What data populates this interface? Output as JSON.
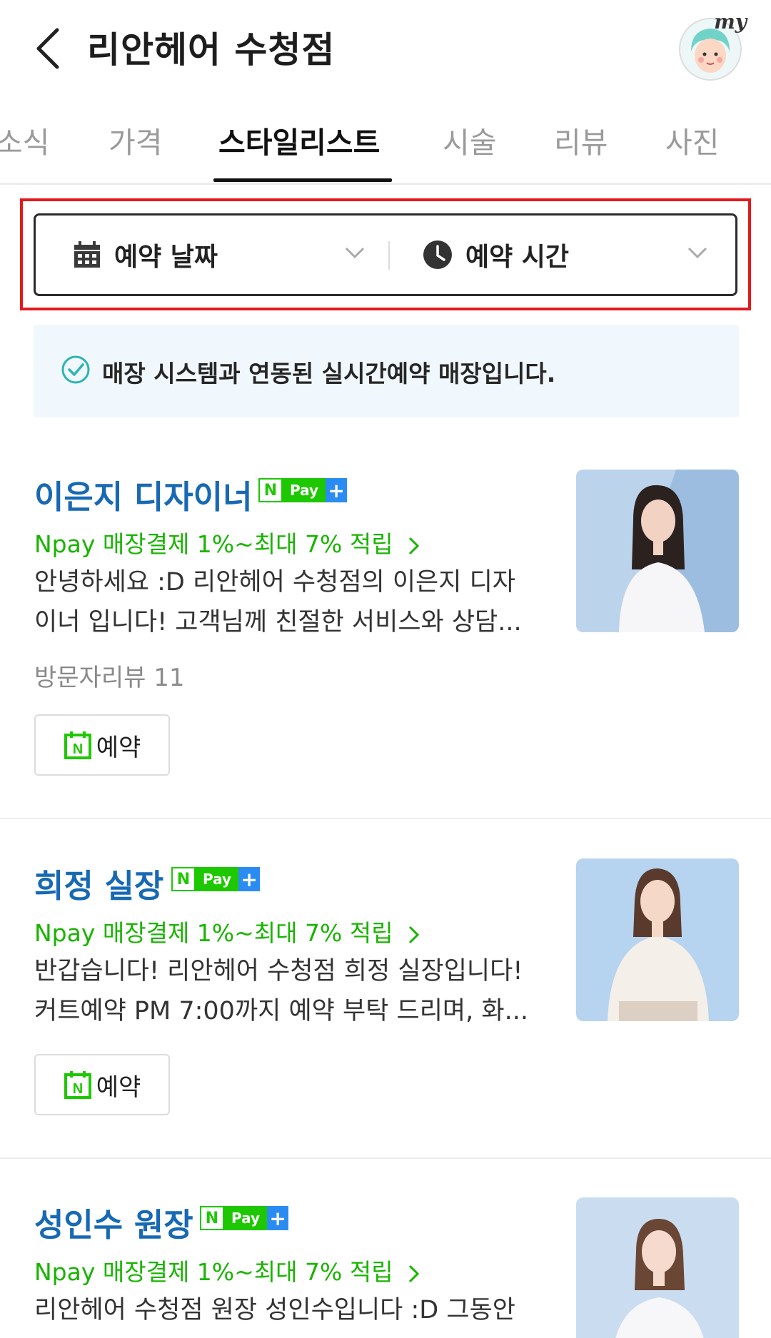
{
  "header": {
    "title": "리안헤어 수청점",
    "avatar_badge": "my"
  },
  "tabs": [
    {
      "label": "소식"
    },
    {
      "label": "가격"
    },
    {
      "label": "스타일리스트",
      "active": true
    },
    {
      "label": "시술"
    },
    {
      "label": "리뷰"
    },
    {
      "label": "사진"
    }
  ],
  "filters": {
    "date_label": "예약 날짜",
    "time_label": "예약 시간"
  },
  "notice": {
    "text": "매장 시스템과 연동된 실시간예약 매장입니다."
  },
  "npay_badge": {
    "n": "N",
    "pay": "Pay",
    "plus": "+"
  },
  "stylists": [
    {
      "name": "이은지 디자이너",
      "promo": "Npay 매장결제 1%~최대 7% 적립",
      "desc_line1": "안녕하세요 :D 리안헤어 수청점의 이은지 디자",
      "desc_line2": "이너 입니다! 고객님께 친절한 서비스와 상담...",
      "reviews": "방문자리뷰 11",
      "reserve_label": "예약"
    },
    {
      "name": "희정 실장",
      "promo": "Npay 매장결제 1%~최대 7% 적립",
      "desc_line1": "반갑습니다! 리안헤어 수청점 희정 실장입니다!",
      "desc_line2": "커트예약 PM 7:00까지 예약 부탁 드리며, 화...",
      "reserve_label": "예약"
    },
    {
      "name": "성인수 원장",
      "promo": "Npay 매장결제 1%~최대 7% 적립",
      "desc_line1": "리안헤어 수청점 원장 성인수입니다 :D 그동안"
    }
  ],
  "colors": {
    "name_blue": "#1769b4",
    "npay_green": "#1ec800",
    "promo_green": "#19b400",
    "highlight_red": "#e3191c",
    "notice_bg": "#f1f8fd"
  }
}
